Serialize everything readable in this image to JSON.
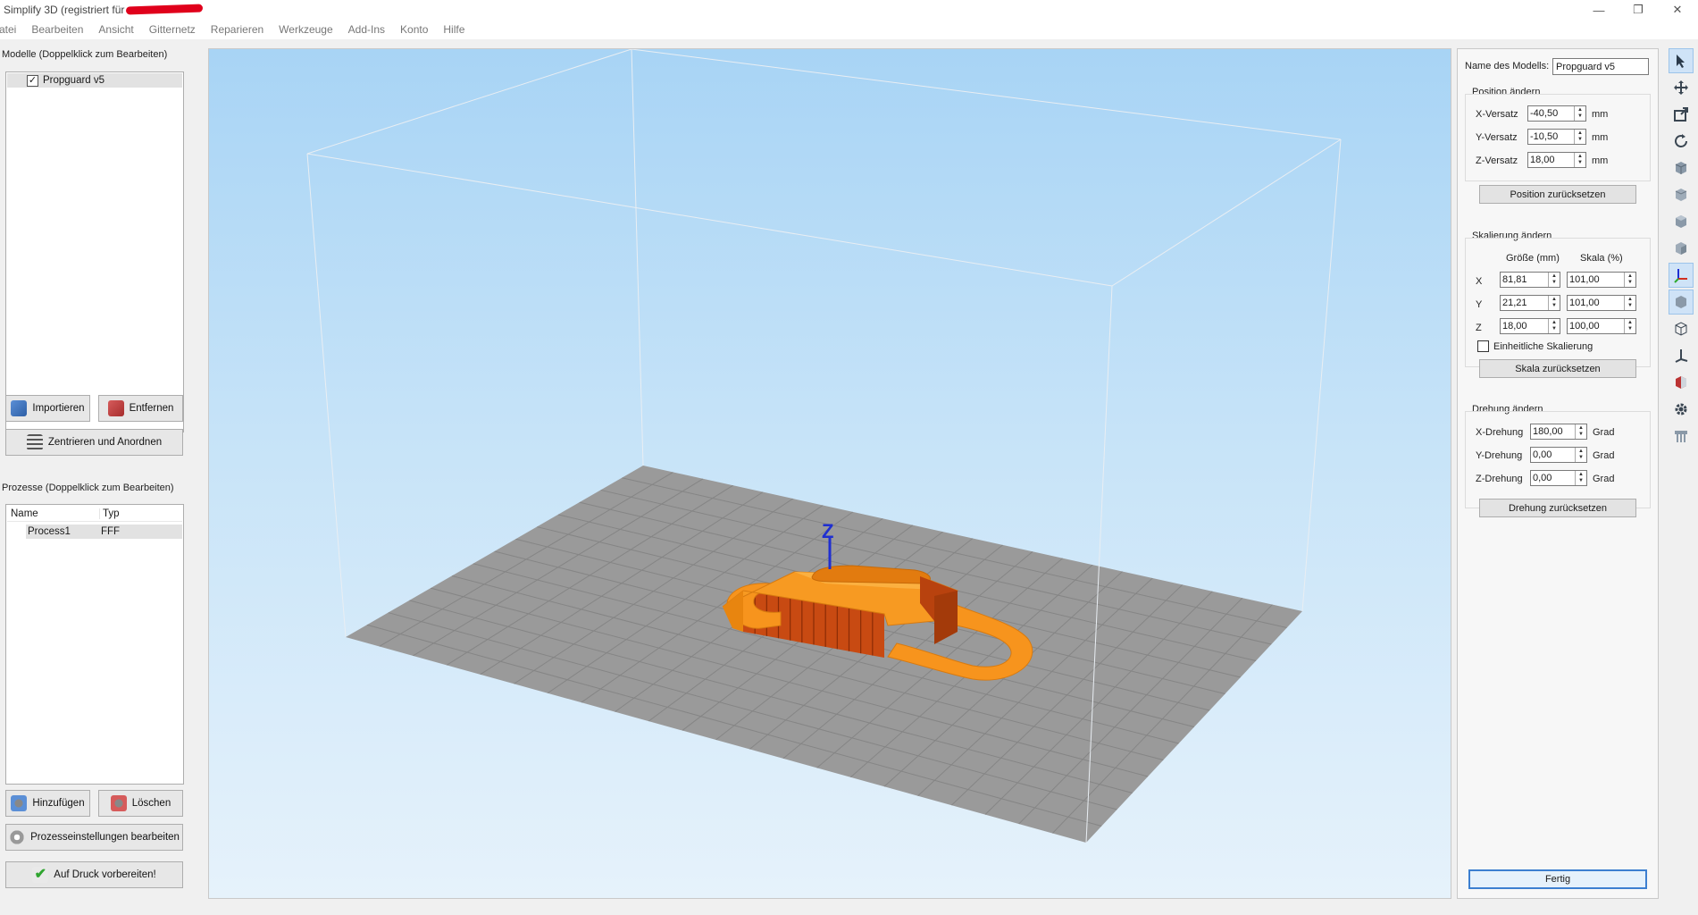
{
  "window": {
    "title": "Simplify 3D (registriert für",
    "minimize": "—",
    "maximize": "❐",
    "close": "✕"
  },
  "menu": [
    "atei",
    "Bearbeiten",
    "Ansicht",
    "Gitternetz",
    "Reparieren",
    "Werkzeuge",
    "Add-Ins",
    "Konto",
    "Hilfe"
  ],
  "models": {
    "label": "Modelle (Doppelklick zum Bearbeiten)",
    "items": [
      {
        "name": "Propguard v5",
        "checked": true
      }
    ],
    "import_label": "Importieren",
    "remove_label": "Entfernen",
    "center_label": "Zentrieren und Anordnen"
  },
  "processes": {
    "label": "Prozesse (Doppelklick zum Bearbeiten)",
    "columns": [
      "Name",
      "Typ"
    ],
    "rows": [
      {
        "name": "Process1",
        "type": "FFF"
      }
    ],
    "add_label": "Hinzufügen",
    "delete_label": "Löschen",
    "edit_label": "Prozesseinstellungen bearbeiten",
    "prepare_label": "Auf Druck vorbereiten!"
  },
  "viewport": {
    "axis_label": "Z"
  },
  "properties": {
    "model_name_label": "Name des Modells:",
    "model_name": "Propguard v5",
    "position": {
      "title": "Position ändern",
      "rows": [
        {
          "label": "X-Versatz",
          "value": "-40,50",
          "unit": "mm"
        },
        {
          "label": "Y-Versatz",
          "value": "-10,50",
          "unit": "mm"
        },
        {
          "label": "Z-Versatz",
          "value": "18,00",
          "unit": "mm"
        }
      ],
      "reset_label": "Position zurücksetzen"
    },
    "scale": {
      "title": "Skalierung ändern",
      "size_header": "Größe (mm)",
      "scale_header": "Skala (%)",
      "rows": [
        {
          "axis": "X",
          "size": "81,81",
          "scale": "101,00"
        },
        {
          "axis": "Y",
          "size": "21,21",
          "scale": "101,00"
        },
        {
          "axis": "Z",
          "size": "18,00",
          "scale": "100,00"
        }
      ],
      "uniform_label": "Einheitliche Skalierung",
      "uniform_checked": false,
      "reset_label": "Skala zurücksetzen"
    },
    "rotation": {
      "title": "Drehung ändern",
      "rows": [
        {
          "label": "X-Drehung",
          "value": "180,00",
          "unit": "Grad"
        },
        {
          "label": "Y-Drehung",
          "value": "0,00",
          "unit": "Grad"
        },
        {
          "label": "Z-Drehung",
          "value": "0,00",
          "unit": "Grad"
        }
      ],
      "reset_label": "Drehung zurücksetzen"
    },
    "done_label": "Fertig"
  },
  "toolbar": [
    "select-tool-icon",
    "move-tool-icon",
    "scale-tool-icon",
    "rotate-tool-icon",
    "view-iso-icon",
    "view-front-icon",
    "view-top-icon",
    "view-side-icon",
    "axes-toggle-icon",
    "solid-view-icon",
    "wireframe-view-icon",
    "axis-single-icon",
    "cross-section-icon",
    "settings-gear-icon",
    "supports-icon"
  ],
  "colors": {
    "model_orange": "#f7941d",
    "model_dark": "#d2541a",
    "bed_gray": "#9a9a9a",
    "accent_blue": "#3c7fd0"
  }
}
